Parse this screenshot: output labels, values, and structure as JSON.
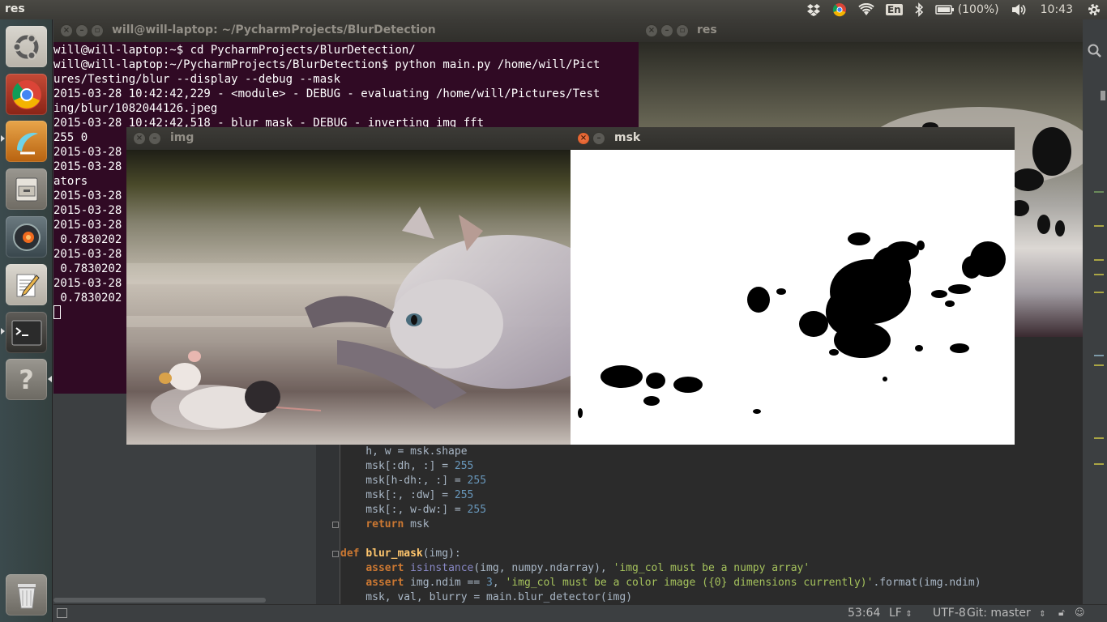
{
  "top_panel": {
    "app_title": "res",
    "battery": "(100%)",
    "clock": "10:43",
    "keyboard_layout": "En"
  },
  "launcher": {
    "items": [
      {
        "name": "ubuntu-dash",
        "icon": "ubuntu-logo-icon"
      },
      {
        "name": "chrome",
        "icon": "chrome-icon"
      },
      {
        "name": "pycharm",
        "icon": "pycharm-icon"
      },
      {
        "name": "files",
        "icon": "file-cabinet-icon"
      },
      {
        "name": "rhythmbox",
        "icon": "speaker-icon"
      },
      {
        "name": "text-editor",
        "icon": "notepad-pencil-icon"
      },
      {
        "name": "terminal",
        "icon": "terminal-icon"
      },
      {
        "name": "help",
        "icon": "question-icon"
      },
      {
        "name": "trash",
        "icon": "trash-icon"
      }
    ]
  },
  "terminal": {
    "title": "will@will-laptop: ~/PycharmProjects/BlurDetection",
    "lines": [
      "will@will-laptop:~$ cd PycharmProjects/BlurDetection/",
      "will@will-laptop:~/PycharmProjects/BlurDetection$ python main.py /home/will/Pict",
      "ures/Testing/blur --display --debug --mask",
      "2015-03-28 10:42:42,229 - <module> - DEBUG - evaluating /home/will/Pictures/Test",
      "ing/blur/1082044126.jpeg",
      "2015-03-28 10:42:42,518 - blur_mask - DEBUG - inverting img_fft",
      "255 0",
      "2015-03-28",
      "2015-03-28",
      "ators",
      "2015-03-28",
      "2015-03-28",
      "2015-03-28",
      " 0.7830202",
      "2015-03-28",
      " 0.7830202",
      "2015-03-28",
      " 0.7830202"
    ]
  },
  "res_window": {
    "title": "res"
  },
  "img_window": {
    "title": "img"
  },
  "msk_window": {
    "title": "msk"
  },
  "editor": {
    "code_lines": [
      {
        "indent": "    ",
        "text": "h, w = msk.shape"
      },
      {
        "indent": "    ",
        "text": "msk[:dh, :] = 255"
      },
      {
        "indent": "    ",
        "text": "msk[h-dh:, :] = 255"
      },
      {
        "indent": "    ",
        "text": "msk[:, :dw] = 255"
      },
      {
        "indent": "    ",
        "text": "msk[:, w-dw:] = 255"
      },
      {
        "indent": "    ",
        "text": "return msk"
      },
      {
        "indent": "",
        "text": ""
      },
      {
        "indent": "",
        "text": "def blur_mask(img):"
      },
      {
        "indent": "    ",
        "text": "assert isinstance(img, numpy.ndarray), 'img_col must be a numpy array'"
      },
      {
        "indent": "    ",
        "text": "assert img.ndim == 3, 'img_col must be a color image ({0} dimensions currently)'.format(img.ndim)"
      },
      {
        "indent": "    ",
        "text": "msk, val, blurry = main.blur_detector(img)"
      }
    ]
  },
  "statusbar": {
    "position": "53:64",
    "line_ending": "LF",
    "encoding": "UTF-8",
    "vcs": "Git: master"
  },
  "colors": {
    "terminal_bg": "#300a24",
    "editor_bg": "#2b2b2b",
    "keyword": "#cc7832",
    "number": "#6897bb",
    "string": "#a5c25c"
  }
}
